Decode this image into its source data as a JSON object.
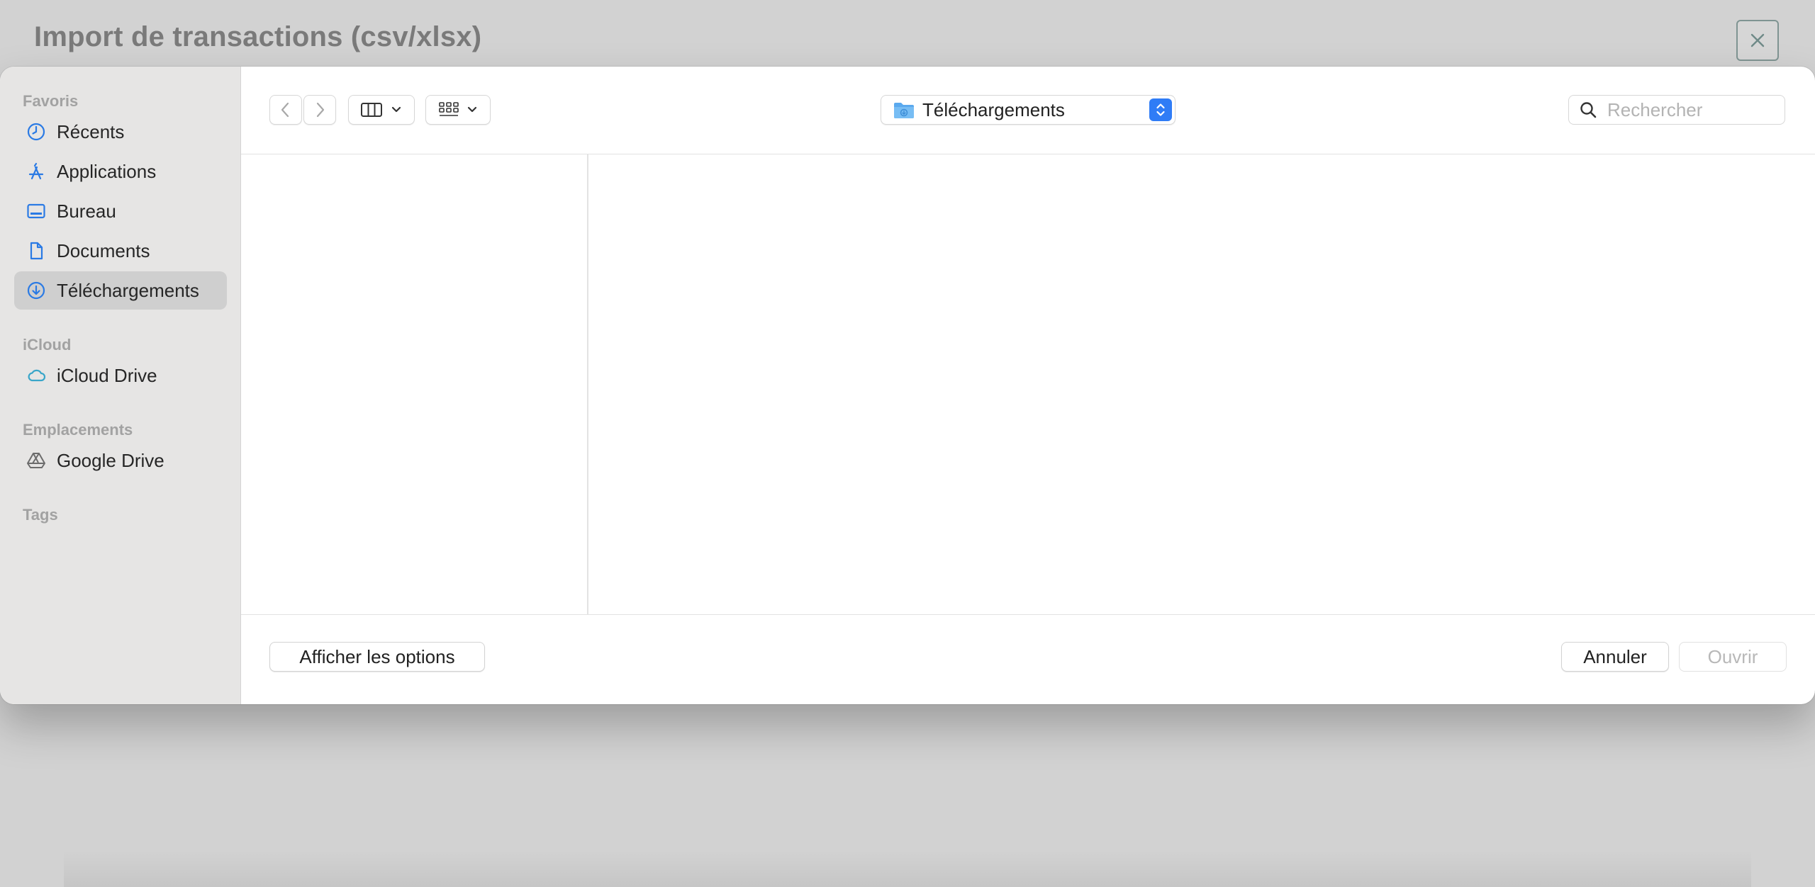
{
  "background_window": {
    "title": "Import de transactions (csv/xlsx)"
  },
  "sidebar": {
    "sections": [
      {
        "label": "Favoris"
      },
      {
        "label": "iCloud"
      },
      {
        "label": "Emplacements"
      },
      {
        "label": "Tags"
      }
    ],
    "items": [
      {
        "label": "Récents",
        "icon": "clock-icon"
      },
      {
        "label": "Applications",
        "icon": "applications-icon"
      },
      {
        "label": "Bureau",
        "icon": "desktop-icon"
      },
      {
        "label": "Documents",
        "icon": "document-icon"
      },
      {
        "label": "Téléchargements",
        "icon": "download-icon",
        "selected": true
      },
      {
        "label": "iCloud Drive",
        "icon": "cloud-icon"
      },
      {
        "label": "Google Drive",
        "icon": "drive-icon"
      }
    ]
  },
  "toolbar": {
    "current_folder": "Téléchargements",
    "search_placeholder": "Rechercher"
  },
  "footer": {
    "options_label": "Afficher les options",
    "cancel_label": "Annuler",
    "open_label": "Ouvrir"
  },
  "colors": {
    "accent": "#2f7cf6",
    "sidebar_icon": "#2a7ae4",
    "cloud_icon": "#3aa6c9"
  }
}
